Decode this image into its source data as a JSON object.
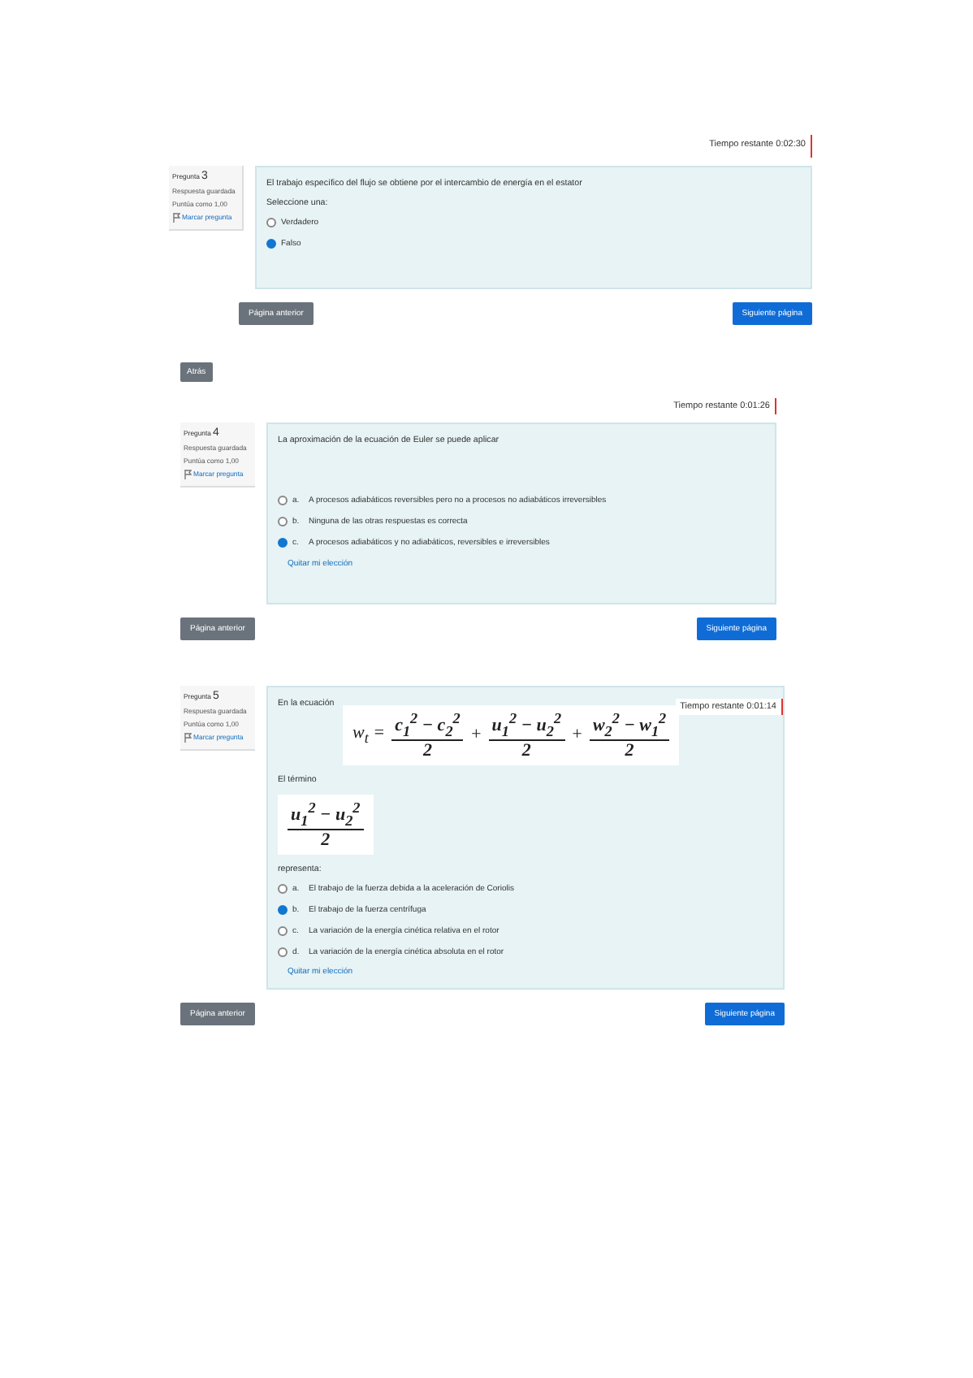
{
  "blocks": [
    {
      "timer": "Tiempo restante 0:02:30",
      "info": {
        "label": "Pregunta",
        "number": "3",
        "status": "Respuesta guardada",
        "points": "Puntúa como 1,00",
        "flag": "Marcar pregunta"
      },
      "prompt": [
        {
          "kind": "text",
          "text": "El trabajo específico del flujo se obtiene por el intercambio de energía en el estator"
        }
      ],
      "instruction": "Seleccione una:",
      "options": [
        {
          "text": "Verdadero",
          "selected": false
        },
        {
          "text": "Falso",
          "selected": true
        }
      ],
      "previous": "Página anterior",
      "next": "Siguiente página",
      "back": "Atrás"
    },
    {
      "timer": "Tiempo restante 0:01:26",
      "info": {
        "label": "Pregunta",
        "number": "4",
        "status": "Respuesta guardada",
        "points": "Puntúa como 1,00",
        "flag": "Marcar pregunta"
      },
      "prompt": [
        {
          "kind": "text",
          "text": "La aproximación de la ecuación de Euler se puede aplicar"
        }
      ],
      "options": [
        {
          "letter": "a.",
          "text": "A procesos adiabáticos reversibles pero no a procesos no adiabáticos irreversibles",
          "selected": false
        },
        {
          "letter": "b.",
          "text": "Ninguna de las otras respuestas es correcta",
          "selected": false
        },
        {
          "letter": "c.",
          "text": "A procesos adiabáticos y no adiabáticos, reversibles e irreversibles",
          "selected": true
        }
      ],
      "clear": "Quitar mi elección",
      "previous": "Página anterior",
      "next": "Siguiente página"
    },
    {
      "timer": "Tiempo restante 0:01:14",
      "info": {
        "label": "Pregunta",
        "number": "5",
        "status": "Respuesta guardada",
        "points": "Puntúa como 1,00",
        "flag": "Marcar pregunta"
      },
      "prompt": [
        {
          "kind": "text",
          "text": "En la ecuación"
        },
        {
          "kind": "formula",
          "items": [
            {
              "kind": "symbol",
              "text": "w$_{t}$ ="
            },
            {
              "kind": "fraction",
              "num": "c$_{1}$$^{2}$ − c$_{2}$$^{2}$",
              "den": "2"
            },
            {
              "kind": "symbol",
              "text": "+"
            },
            {
              "kind": "fraction",
              "num": "u$_{1}$$^{2}$ − u$_{2}$$^{2}$",
              "den": "2"
            },
            {
              "kind": "symbol",
              "text": "+"
            },
            {
              "kind": "fraction",
              "num": "w$_{2}$$^{2}$ − w$_{1}$$^{2}$",
              "den": "2"
            }
          ]
        },
        {
          "kind": "text",
          "text": "El término"
        },
        {
          "kind": "formula",
          "items": [
            {
              "kind": "fraction",
              "num": "u$_{1}$$^{2}$ − u$_{2}$$^{2}$",
              "den": "2"
            }
          ]
        },
        {
          "kind": "text",
          "text": "representa:"
        }
      ],
      "options": [
        {
          "letter": "a.",
          "text": "El trabajo de la fuerza debida a la aceleración de Coriolis",
          "selected": false
        },
        {
          "letter": "b.",
          "text": "El trabajo de la fuerza centrífuga",
          "selected": true
        },
        {
          "letter": "c.",
          "text": "La variación de la energía cinética relativa en el rotor",
          "selected": false
        },
        {
          "letter": "d.",
          "text": "La variación de la energía cinética absoluta en el rotor",
          "selected": false
        }
      ],
      "clear": "Quitar mi elección",
      "previous": "Página anterior",
      "next": "Siguiente página"
    }
  ]
}
